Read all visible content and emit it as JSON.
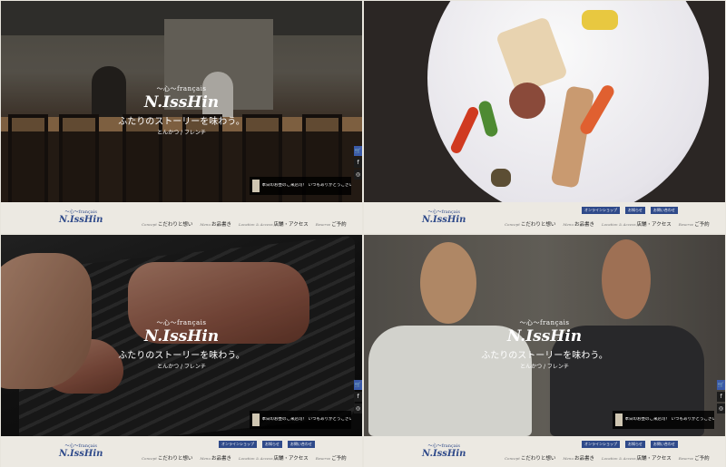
{
  "site": {
    "logo_tag": "〜心〜français",
    "logo_main": "N.IssHin",
    "tagline": "ふたりのストーリーを味わう。",
    "subtag": "とんかつ / フレンチ"
  },
  "chat": {
    "message": "本日のお昼のご来店可！ いつもありがとうございます！ こちらの本日のお席のご案内です"
  },
  "side_buttons": [
    "cart-icon",
    "facebook-icon",
    "instagram-icon"
  ],
  "side_glyphs": {
    "cart": "🛒",
    "facebook": "f",
    "instagram": "◎"
  },
  "header": {
    "top_links": [
      "オンラインショップ",
      "お知らせ",
      "お問い合わせ"
    ],
    "nav": [
      {
        "en": "Concept",
        "label": "こだわりと想い"
      },
      {
        "en": "Menu",
        "label": "お品書き"
      },
      {
        "en": "Location & Access",
        "label": "店舗・アクセス"
      },
      {
        "en": "Reserve",
        "label": "ご予約"
      }
    ]
  },
  "colors": {
    "brand": "#2f4a8a",
    "background": "#ece9e2",
    "chat_bg": "#000000"
  }
}
